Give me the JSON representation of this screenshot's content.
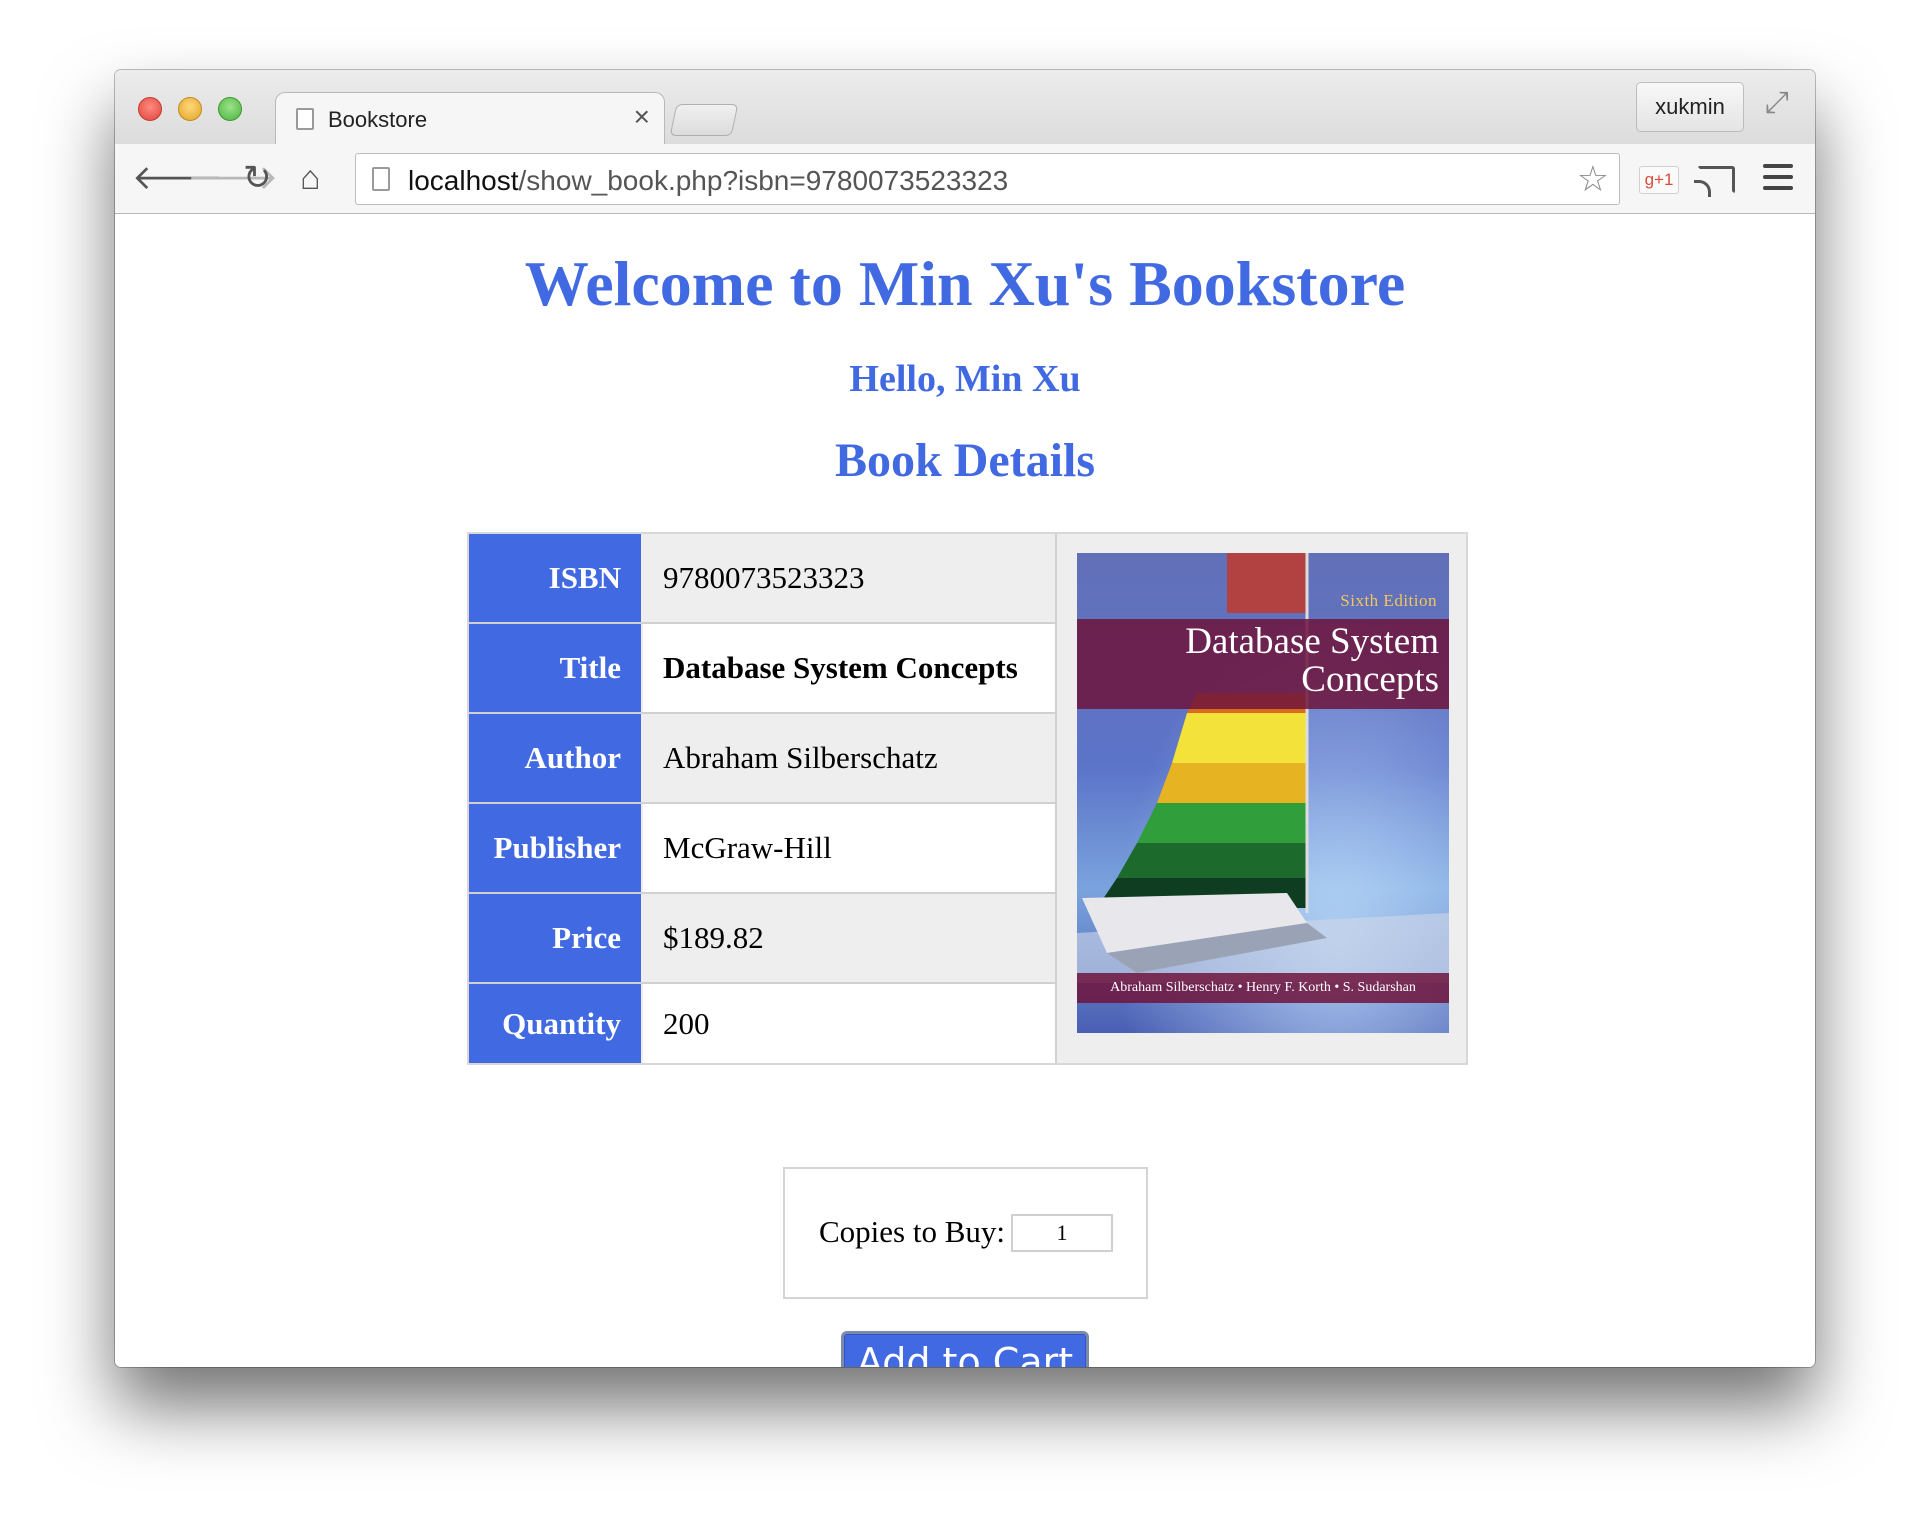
{
  "browser": {
    "tab_title": "Bookstore",
    "tab_close": "×",
    "profile_name": "xukmin",
    "url_host": "localhost",
    "url_path": "/show_book.php?isbn=9780073523323",
    "gplus_label": "g+1"
  },
  "page": {
    "site_title": "Welcome to Min Xu's Bookstore",
    "greeting": "Hello, Min Xu",
    "section_title": "Book Details"
  },
  "book": {
    "rows": [
      {
        "label": "ISBN",
        "value": "9780073523323"
      },
      {
        "label": "Title",
        "value": "Database System Concepts"
      },
      {
        "label": "Author",
        "value": "Abraham Silberschatz"
      },
      {
        "label": "Publisher",
        "value": "McGraw-Hill"
      },
      {
        "label": "Price",
        "value": "$189.82"
      },
      {
        "label": "Quantity",
        "value": "200"
      }
    ],
    "cover": {
      "edition": "Sixth Edition",
      "title_line1": "Database System",
      "title_line2": "Concepts",
      "authors": "Abraham Silberschatz • Henry F. Korth • S. Sudarshan"
    }
  },
  "purchase": {
    "copies_label": "Copies to Buy:",
    "copies_value": "1",
    "add_button": "Add to Cart"
  },
  "colors": {
    "accent": "#4169e1",
    "table_bg": "#eeeeee"
  }
}
